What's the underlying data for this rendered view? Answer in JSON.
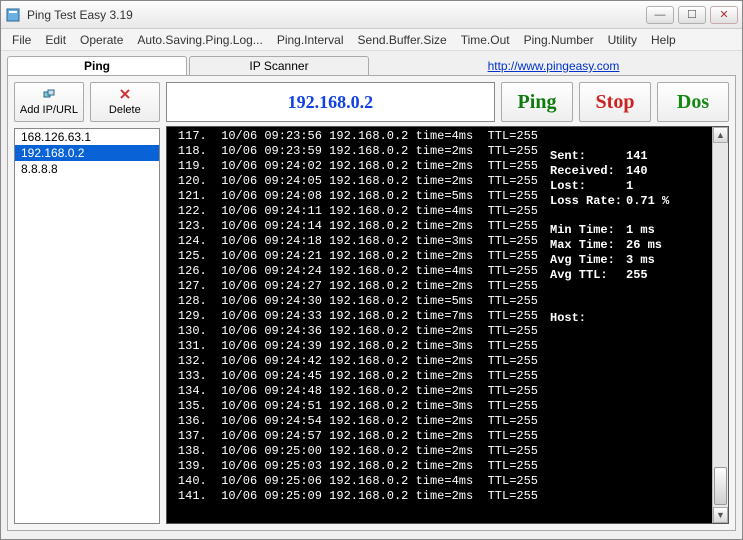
{
  "window": {
    "title": "Ping Test Easy 3.19"
  },
  "menu": {
    "file": "File",
    "edit": "Edit",
    "operate": "Operate",
    "autosave": "Auto.Saving.Ping.Log...",
    "interval": "Ping.Interval",
    "buffersize": "Send.Buffer.Size",
    "timeout": "Time.Out",
    "pingnumber": "Ping.Number",
    "utility": "Utility",
    "help": "Help"
  },
  "tabs": {
    "ping": "Ping",
    "scanner": "IP Scanner",
    "link": "http://www.pingeasy.com"
  },
  "left": {
    "add_label": "Add IP/URL",
    "delete_label": "Delete",
    "items": [
      {
        "ip": "168.126.63.1",
        "selected": false
      },
      {
        "ip": "192.168.0.2",
        "selected": true
      },
      {
        "ip": "8.8.8.8",
        "selected": false
      }
    ]
  },
  "controls": {
    "current_ip": "192.168.0.2",
    "ping_label": "Ping",
    "stop_label": "Stop",
    "dos_label": "Dos"
  },
  "stats": {
    "sent_label": "Sent:",
    "sent": "141",
    "received_label": "Received:",
    "received": "140",
    "lost_label": "Lost:",
    "lost": "1",
    "lossrate_label": "Loss Rate:",
    "lossrate": "0.71 %",
    "min_label": "Min Time:",
    "min": "1 ms",
    "max_label": "Max Time:",
    "max": "26 ms",
    "avg_label": "Avg Time:",
    "avg": "3 ms",
    "avgttl_label": "Avg TTL:",
    "avgttl": "255",
    "host_label": "Host:",
    "host": ""
  },
  "log": [
    {
      "n": "117",
      "ts": "10/06 09:23:56",
      "ip": "192.168.0.2",
      "time": "4ms",
      "ttl": "255"
    },
    {
      "n": "118",
      "ts": "10/06 09:23:59",
      "ip": "192.168.0.2",
      "time": "2ms",
      "ttl": "255"
    },
    {
      "n": "119",
      "ts": "10/06 09:24:02",
      "ip": "192.168.0.2",
      "time": "2ms",
      "ttl": "255"
    },
    {
      "n": "120",
      "ts": "10/06 09:24:05",
      "ip": "192.168.0.2",
      "time": "2ms",
      "ttl": "255"
    },
    {
      "n": "121",
      "ts": "10/06 09:24:08",
      "ip": "192.168.0.2",
      "time": "5ms",
      "ttl": "255"
    },
    {
      "n": "122",
      "ts": "10/06 09:24:11",
      "ip": "192.168.0.2",
      "time": "4ms",
      "ttl": "255"
    },
    {
      "n": "123",
      "ts": "10/06 09:24:14",
      "ip": "192.168.0.2",
      "time": "2ms",
      "ttl": "255"
    },
    {
      "n": "124",
      "ts": "10/06 09:24:18",
      "ip": "192.168.0.2",
      "time": "3ms",
      "ttl": "255"
    },
    {
      "n": "125",
      "ts": "10/06 09:24:21",
      "ip": "192.168.0.2",
      "time": "2ms",
      "ttl": "255"
    },
    {
      "n": "126",
      "ts": "10/06 09:24:24",
      "ip": "192.168.0.2",
      "time": "4ms",
      "ttl": "255"
    },
    {
      "n": "127",
      "ts": "10/06 09:24:27",
      "ip": "192.168.0.2",
      "time": "2ms",
      "ttl": "255"
    },
    {
      "n": "128",
      "ts": "10/06 09:24:30",
      "ip": "192.168.0.2",
      "time": "5ms",
      "ttl": "255"
    },
    {
      "n": "129",
      "ts": "10/06 09:24:33",
      "ip": "192.168.0.2",
      "time": "7ms",
      "ttl": "255"
    },
    {
      "n": "130",
      "ts": "10/06 09:24:36",
      "ip": "192.168.0.2",
      "time": "2ms",
      "ttl": "255"
    },
    {
      "n": "131",
      "ts": "10/06 09:24:39",
      "ip": "192.168.0.2",
      "time": "3ms",
      "ttl": "255"
    },
    {
      "n": "132",
      "ts": "10/06 09:24:42",
      "ip": "192.168.0.2",
      "time": "2ms",
      "ttl": "255"
    },
    {
      "n": "133",
      "ts": "10/06 09:24:45",
      "ip": "192.168.0.2",
      "time": "2ms",
      "ttl": "255"
    },
    {
      "n": "134",
      "ts": "10/06 09:24:48",
      "ip": "192.168.0.2",
      "time": "2ms",
      "ttl": "255"
    },
    {
      "n": "135",
      "ts": "10/06 09:24:51",
      "ip": "192.168.0.2",
      "time": "3ms",
      "ttl": "255"
    },
    {
      "n": "136",
      "ts": "10/06 09:24:54",
      "ip": "192.168.0.2",
      "time": "2ms",
      "ttl": "255"
    },
    {
      "n": "137",
      "ts": "10/06 09:24:57",
      "ip": "192.168.0.2",
      "time": "2ms",
      "ttl": "255"
    },
    {
      "n": "138",
      "ts": "10/06 09:25:00",
      "ip": "192.168.0.2",
      "time": "2ms",
      "ttl": "255"
    },
    {
      "n": "139",
      "ts": "10/06 09:25:03",
      "ip": "192.168.0.2",
      "time": "2ms",
      "ttl": "255"
    },
    {
      "n": "140",
      "ts": "10/06 09:25:06",
      "ip": "192.168.0.2",
      "time": "4ms",
      "ttl": "255"
    },
    {
      "n": "141",
      "ts": "10/06 09:25:09",
      "ip": "192.168.0.2",
      "time": "2ms",
      "ttl": "255"
    }
  ]
}
